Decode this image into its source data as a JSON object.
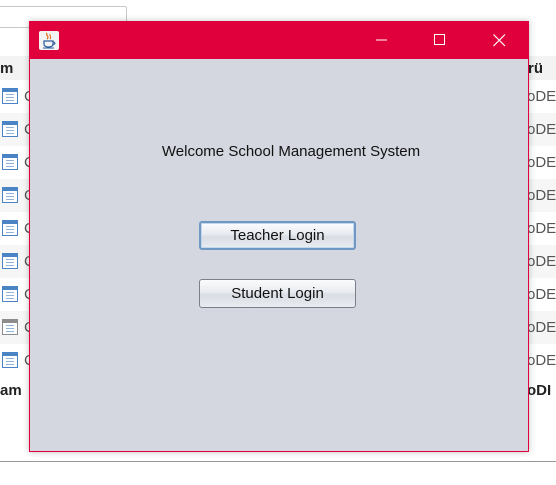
{
  "background": {
    "header": {
      "left": "m",
      "right": "rü"
    },
    "rows": [
      {
        "left": "C",
        "right": "oDE"
      },
      {
        "left": "C",
        "right": "oDE"
      },
      {
        "left": "C",
        "right": "oDE"
      },
      {
        "left": "C",
        "right": "oDE"
      },
      {
        "left": "C",
        "right": "oDE"
      },
      {
        "left": "C",
        "right": "oDE"
      },
      {
        "left": "C",
        "right": "oDE"
      },
      {
        "left": "C",
        "right": "oDE"
      },
      {
        "left": "C",
        "right": "oDE"
      }
    ],
    "footer": {
      "left": "am",
      "right": "oDI"
    }
  },
  "window": {
    "icon": "java-icon",
    "controls": {
      "minimize": "minimize-icon",
      "maximize": "maximize-icon",
      "close": "close-icon"
    }
  },
  "main": {
    "welcome": "Welcome School Management System",
    "teacher_button": "Teacher Login",
    "student_button": "Student Login"
  },
  "colors": {
    "titlebar": "#e0003c",
    "window_bg": "#d4d7df",
    "button_focus": "#6f98c4"
  }
}
